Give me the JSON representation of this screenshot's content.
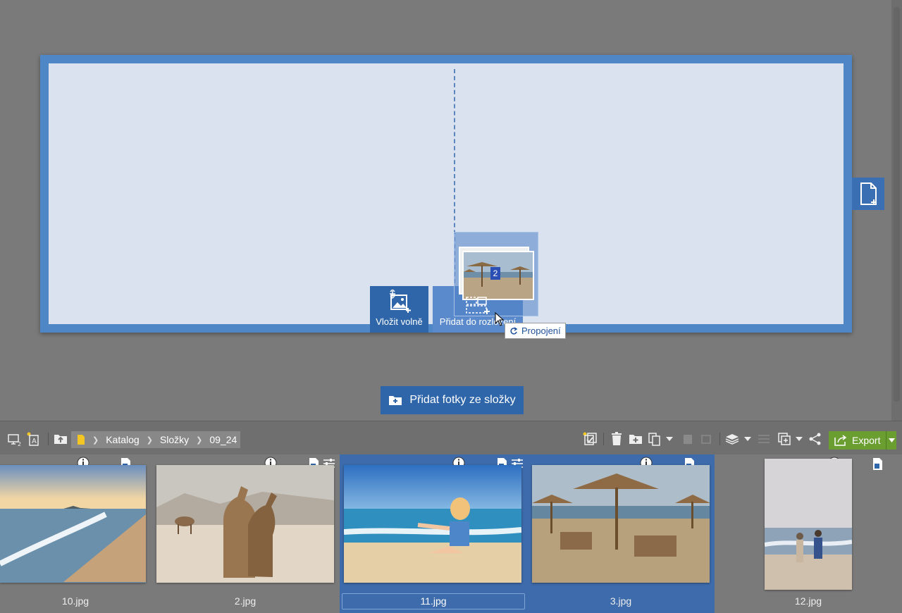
{
  "colors": {
    "canvas_bg": "#7a7a7a",
    "spread_border": "#4f86c6",
    "page_fill": "#d9e2ee",
    "accent_blue": "#2f66aa",
    "selected_bg": "#3d6bab",
    "export_green": "#6b9e31"
  },
  "drop_zones": {
    "free_label": "Vložit volně",
    "spread_label": "Přidat do rozložení"
  },
  "drag": {
    "count": "2"
  },
  "tooltip": {
    "text": "Propojení"
  },
  "add_from_folder": {
    "label": "Přidat fotky ze složky"
  },
  "breadcrumb": {
    "items": [
      "Katalog",
      "Složky",
      "09_24"
    ]
  },
  "toolbar": {
    "export_label": "Export"
  },
  "filmstrip": {
    "items": [
      {
        "name": "10.jpg",
        "selected": false
      },
      {
        "name": "2.jpg",
        "selected": false
      },
      {
        "name": "11.jpg",
        "selected": true
      },
      {
        "name": "3.jpg",
        "selected": true
      },
      {
        "name": "12.jpg",
        "selected": false
      }
    ]
  },
  "icons": {
    "add_page": "add-page-icon",
    "layout_toggle": "layout-icon",
    "text_box": "text-image-icon",
    "folder_up": "folder-up-icon",
    "select_all": "select-check-icon",
    "delete": "trash-icon",
    "move_to_folder": "folder-plus-icon",
    "copy": "copy-icon",
    "stack": "stack-icon",
    "share": "share-icon"
  }
}
